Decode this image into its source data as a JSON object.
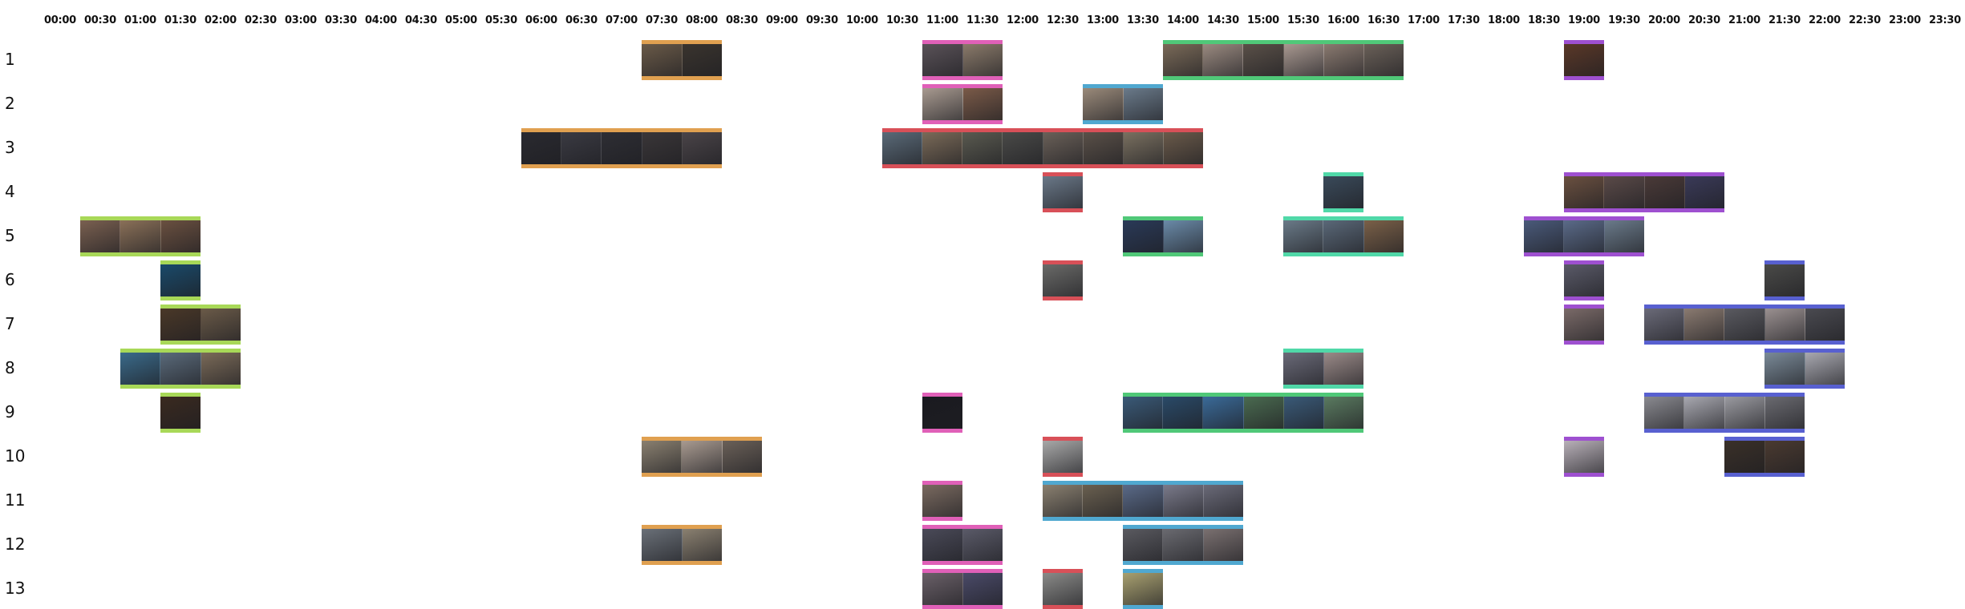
{
  "timeline": {
    "hours": [
      "00:00",
      "00:30",
      "01:00",
      "01:30",
      "02:00",
      "02:30",
      "03:00",
      "03:30",
      "04:00",
      "04:30",
      "05:00",
      "05:30",
      "06:00",
      "06:30",
      "07:00",
      "07:30",
      "08:00",
      "08:30",
      "09:00",
      "09:30",
      "10:00",
      "10:30",
      "11:00",
      "11:30",
      "12:00",
      "12:30",
      "13:00",
      "13:30",
      "14:00",
      "14:30",
      "15:00",
      "15:30",
      "16:00",
      "16:30",
      "17:00",
      "17:30",
      "18:00",
      "18:30",
      "19:00",
      "19:30",
      "20:00",
      "20:30",
      "21:00",
      "21:30",
      "22:00",
      "22:30",
      "23:00",
      "23:30"
    ],
    "rows": [
      "1",
      "2",
      "3",
      "4",
      "5",
      "6",
      "7",
      "8",
      "9",
      "10",
      "11",
      "12",
      "13"
    ],
    "colors": {
      "orange": "#e0a050",
      "pink": "#e060b8",
      "green": "#50c878",
      "purple": "#9e50d0",
      "blue": "#50a8d0",
      "red": "#d85058",
      "lime": "#a8d858",
      "teal": "#50d8a8",
      "indigo": "#5860d0"
    },
    "clusters": [
      {
        "row": 1,
        "start": "07:30",
        "slots": 2,
        "color": "orange",
        "tones": [
          "#6a5a48",
          "#3a342e"
        ]
      },
      {
        "row": 1,
        "start": "11:00",
        "slots": 2,
        "color": "pink",
        "tones": [
          "#5a5258",
          "#8a7a6a"
        ]
      },
      {
        "row": 1,
        "start": "14:00",
        "slots": 6,
        "color": "green",
        "tones": [
          "#7a6a58",
          "#9a8a80",
          "#5a5048",
          "#a89890",
          "#8a7a70",
          "#6a6058"
        ]
      },
      {
        "row": 1,
        "start": "19:00",
        "slots": 1,
        "color": "purple",
        "tones": [
          "#5a3828"
        ]
      },
      {
        "row": 2,
        "start": "11:00",
        "slots": 2,
        "color": "pink",
        "tones": [
          "#a89a90",
          "#7a5a48"
        ]
      },
      {
        "row": 2,
        "start": "13:00",
        "slots": 2,
        "color": "blue",
        "tones": [
          "#9a8a7a",
          "#6a7a8a"
        ]
      },
      {
        "row": 3,
        "start": "06:00",
        "slots": 5,
        "color": "orange",
        "tones": [
          "#2a2a30",
          "#3a3a42",
          "#2e2e34",
          "#3a3638",
          "#4a4448"
        ]
      },
      {
        "row": 3,
        "start": "10:30",
        "slots": 8,
        "color": "red",
        "tones": [
          "#5a6a78",
          "#7a6a58",
          "#5a5a50",
          "#4a4a48",
          "#6a6058",
          "#5a5048",
          "#7a7060",
          "#6a5a4a"
        ]
      },
      {
        "row": 4,
        "start": "12:30",
        "slots": 1,
        "color": "red",
        "tones": [
          "#6a7888"
        ]
      },
      {
        "row": 4,
        "start": "16:00",
        "slots": 1,
        "color": "teal",
        "tones": [
          "#3a4a5a"
        ]
      },
      {
        "row": 4,
        "start": "19:00",
        "slots": 4,
        "color": "purple",
        "tones": [
          "#6a5040",
          "#5a4a48",
          "#4a3a38",
          "#3a3a58"
        ]
      },
      {
        "row": 5,
        "start": "00:30",
        "slots": 3,
        "color": "lime",
        "tones": [
          "#7a6050",
          "#8a7058",
          "#6a5040"
        ]
      },
      {
        "row": 5,
        "start": "13:30",
        "slots": 2,
        "color": "green",
        "tones": [
          "#2a3a58",
          "#6a8aa8"
        ]
      },
      {
        "row": 5,
        "start": "15:30",
        "slots": 3,
        "color": "teal",
        "tones": [
          "#6a7a88",
          "#5a6878",
          "#7a6048"
        ]
      },
      {
        "row": 5,
        "start": "18:30",
        "slots": 3,
        "color": "purple",
        "tones": [
          "#4a5a7a",
          "#5a6a88",
          "#6a7a8a"
        ]
      },
      {
        "row": 6,
        "start": "01:30",
        "slots": 1,
        "color": "lime",
        "tones": [
          "#1a4a6a"
        ]
      },
      {
        "row": 6,
        "start": "12:30",
        "slots": 1,
        "color": "red",
        "tones": [
          "#6a6a68"
        ]
      },
      {
        "row": 6,
        "start": "19:00",
        "slots": 1,
        "color": "purple",
        "tones": [
          "#5a5a68"
        ]
      },
      {
        "row": 6,
        "start": "21:30",
        "slots": 1,
        "color": "indigo",
        "tones": [
          "#4a4a48"
        ]
      },
      {
        "row": 7,
        "start": "01:30",
        "slots": 2,
        "color": "lime",
        "tones": [
          "#4a3828",
          "#6a5a48"
        ]
      },
      {
        "row": 7,
        "start": "19:00",
        "slots": 1,
        "color": "purple",
        "tones": [
          "#7a6a68"
        ]
      },
      {
        "row": 7,
        "start": "20:00",
        "slots": 5,
        "color": "indigo",
        "tones": [
          "#6a6a78",
          "#8a7a70",
          "#5a5a60",
          "#9a9090",
          "#4a4a50"
        ]
      },
      {
        "row": 8,
        "start": "01:00",
        "slots": 3,
        "color": "lime",
        "tones": [
          "#3a6a8a",
          "#5a6a7a",
          "#7a6a58"
        ]
      },
      {
        "row": 8,
        "start": "15:30",
        "slots": 2,
        "color": "teal",
        "tones": [
          "#6a6a78",
          "#9a8a88"
        ]
      },
      {
        "row": 8,
        "start": "21:30",
        "slots": 2,
        "color": "indigo",
        "tones": [
          "#7a8a98",
          "#a8a8b0"
        ]
      },
      {
        "row": 9,
        "start": "01:30",
        "slots": 1,
        "color": "lime",
        "tones": [
          "#3a2a20"
        ]
      },
      {
        "row": 9,
        "start": "11:00",
        "slots": 1,
        "color": "pink",
        "tones": [
          "#1a1a20"
        ]
      },
      {
        "row": 9,
        "start": "13:30",
        "slots": 6,
        "color": "green",
        "tones": [
          "#3a5a78",
          "#2a4a68",
          "#3a6a98",
          "#4a6a50",
          "#3a5a78",
          "#5a7a60"
        ]
      },
      {
        "row": 9,
        "start": "20:00",
        "slots": 4,
        "color": "indigo",
        "tones": [
          "#8a8a90",
          "#a8a8b0",
          "#9a9aa0",
          "#6a6a70"
        ]
      },
      {
        "row": 10,
        "start": "07:30",
        "slots": 3,
        "color": "orange",
        "tones": [
          "#8a8070",
          "#a89a90",
          "#6a6058"
        ]
      },
      {
        "row": 10,
        "start": "12:30",
        "slots": 1,
        "color": "red",
        "tones": [
          "#a8a8a8"
        ]
      },
      {
        "row": 10,
        "start": "19:00",
        "slots": 1,
        "color": "purple",
        "tones": [
          "#b8b0b8"
        ]
      },
      {
        "row": 10,
        "start": "21:00",
        "slots": 2,
        "color": "indigo",
        "tones": [
          "#3a3028",
          "#4a3a30"
        ]
      },
      {
        "row": 11,
        "start": "11:00",
        "slots": 1,
        "color": "pink",
        "tones": [
          "#7a6a60"
        ]
      },
      {
        "row": 11,
        "start": "12:30",
        "slots": 5,
        "color": "blue",
        "tones": [
          "#8a8070",
          "#6a6050",
          "#5a6a88",
          "#7a7a8a",
          "#6a6a78"
        ]
      },
      {
        "row": 12,
        "start": "07:30",
        "slots": 2,
        "color": "orange",
        "tones": [
          "#6a7078",
          "#8a8070"
        ]
      },
      {
        "row": 12,
        "start": "11:00",
        "slots": 2,
        "color": "pink",
        "tones": [
          "#4a4a58",
          "#5a5a68"
        ]
      },
      {
        "row": 12,
        "start": "13:30",
        "slots": 3,
        "color": "blue",
        "tones": [
          "#5a5a60",
          "#6a6a70",
          "#7a7070"
        ]
      },
      {
        "row": 13,
        "start": "11:00",
        "slots": 2,
        "color": "pink",
        "tones": [
          "#6a6068",
          "#4a4a68"
        ]
      },
      {
        "row": 13,
        "start": "12:30",
        "slots": 1,
        "color": "red",
        "tones": [
          "#8a8a88"
        ]
      },
      {
        "row": 13,
        "start": "13:30",
        "slots": 1,
        "color": "blue",
        "tones": [
          "#a8a070"
        ]
      }
    ]
  }
}
